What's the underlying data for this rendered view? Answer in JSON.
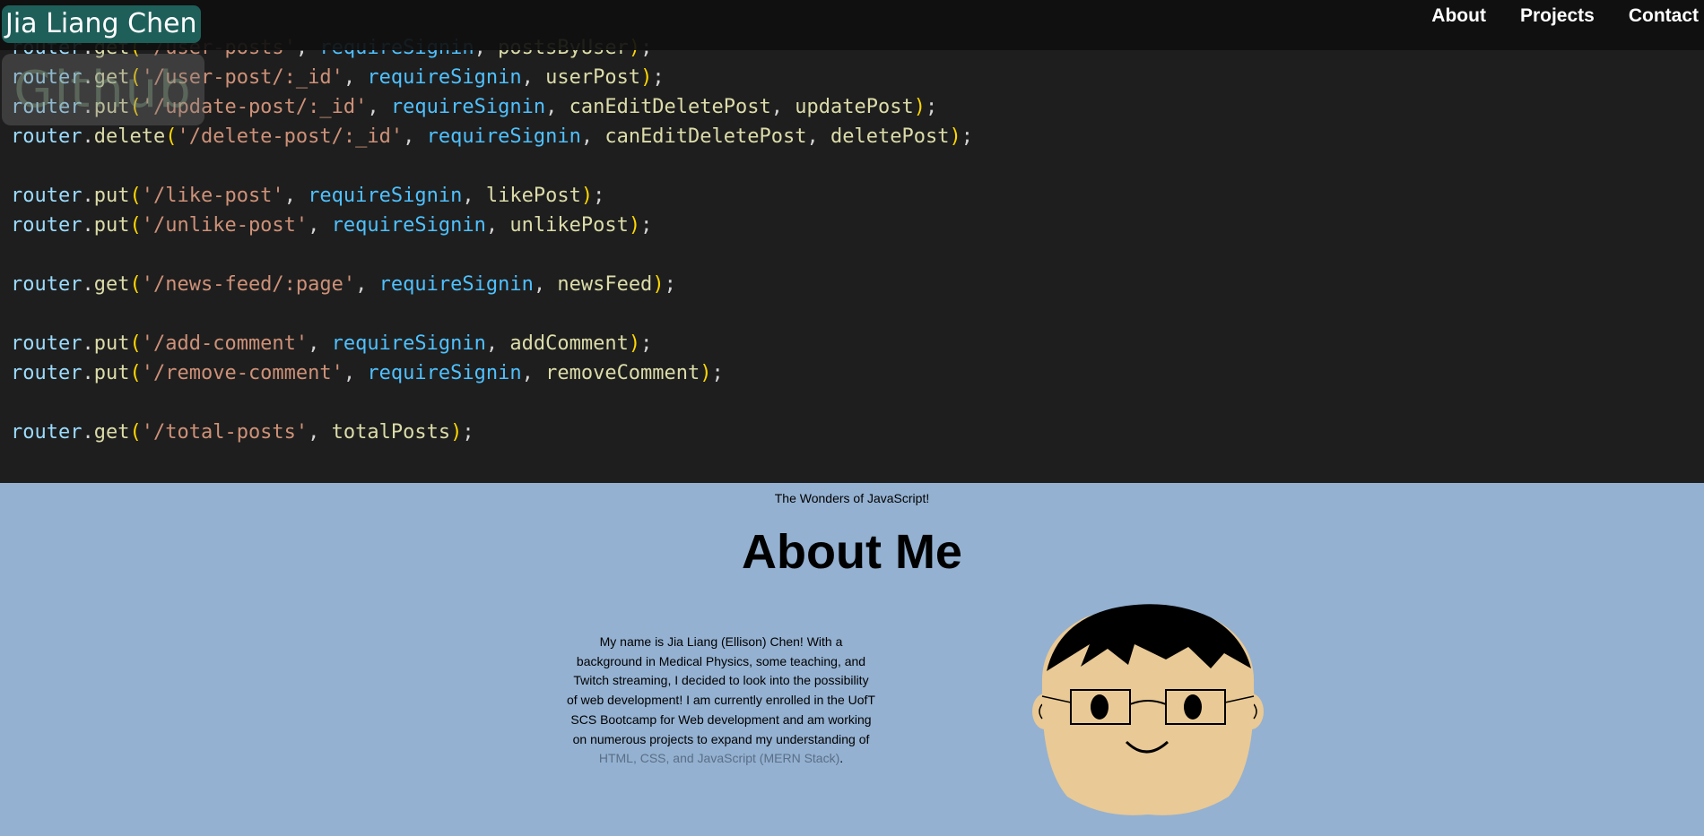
{
  "nav": {
    "brand": "Jia Liang Chen",
    "links": [
      "About",
      "Projects",
      "Contact"
    ]
  },
  "hero": {
    "github_label": "Github",
    "code_lines": [
      [
        {
          "t": "router",
          "c": "obj"
        },
        {
          "t": ".",
          "c": "punc"
        },
        {
          "t": "get",
          "c": "fn"
        },
        {
          "t": "(",
          "c": "paren"
        },
        {
          "t": "'/user-posts'",
          "c": "str"
        },
        {
          "t": ", ",
          "c": "punc"
        },
        {
          "t": "requireSignin",
          "c": "mw"
        },
        {
          "t": ", ",
          "c": "punc"
        },
        {
          "t": "postsByUser",
          "c": "handler"
        },
        {
          "t": ")",
          "c": "paren"
        },
        {
          "t": ";",
          "c": "punc"
        }
      ],
      [
        {
          "t": "router",
          "c": "obj"
        },
        {
          "t": ".",
          "c": "punc"
        },
        {
          "t": "get",
          "c": "fn"
        },
        {
          "t": "(",
          "c": "paren"
        },
        {
          "t": "'/user-post/:_id'",
          "c": "str"
        },
        {
          "t": ", ",
          "c": "punc"
        },
        {
          "t": "requireSignin",
          "c": "mw"
        },
        {
          "t": ", ",
          "c": "punc"
        },
        {
          "t": "userPost",
          "c": "handler"
        },
        {
          "t": ")",
          "c": "paren"
        },
        {
          "t": ";",
          "c": "punc"
        }
      ],
      [
        {
          "t": "router",
          "c": "obj"
        },
        {
          "t": ".",
          "c": "punc"
        },
        {
          "t": "put",
          "c": "fn"
        },
        {
          "t": "(",
          "c": "paren"
        },
        {
          "t": "'/update-post/:_id'",
          "c": "str"
        },
        {
          "t": ", ",
          "c": "punc"
        },
        {
          "t": "requireSignin",
          "c": "mw"
        },
        {
          "t": ", ",
          "c": "punc"
        },
        {
          "t": "canEditDeletePost",
          "c": "handler"
        },
        {
          "t": ", ",
          "c": "punc"
        },
        {
          "t": "updatePost",
          "c": "handler"
        },
        {
          "t": ")",
          "c": "paren"
        },
        {
          "t": ";",
          "c": "punc"
        }
      ],
      [
        {
          "t": "router",
          "c": "obj"
        },
        {
          "t": ".",
          "c": "punc"
        },
        {
          "t": "delete",
          "c": "fn"
        },
        {
          "t": "(",
          "c": "paren"
        },
        {
          "t": "'/delete-post/:_id'",
          "c": "str"
        },
        {
          "t": ", ",
          "c": "punc"
        },
        {
          "t": "requireSignin",
          "c": "mw"
        },
        {
          "t": ", ",
          "c": "punc"
        },
        {
          "t": "canEditDeletePost",
          "c": "handler"
        },
        {
          "t": ", ",
          "c": "punc"
        },
        {
          "t": "deletePost",
          "c": "handler"
        },
        {
          "t": ")",
          "c": "paren"
        },
        {
          "t": ";",
          "c": "punc"
        }
      ],
      [],
      [
        {
          "t": "router",
          "c": "obj"
        },
        {
          "t": ".",
          "c": "punc"
        },
        {
          "t": "put",
          "c": "fn"
        },
        {
          "t": "(",
          "c": "paren"
        },
        {
          "t": "'/like-post'",
          "c": "str"
        },
        {
          "t": ", ",
          "c": "punc"
        },
        {
          "t": "requireSignin",
          "c": "mw"
        },
        {
          "t": ", ",
          "c": "punc"
        },
        {
          "t": "likePost",
          "c": "handler"
        },
        {
          "t": ")",
          "c": "paren"
        },
        {
          "t": ";",
          "c": "punc"
        }
      ],
      [
        {
          "t": "router",
          "c": "obj"
        },
        {
          "t": ".",
          "c": "punc"
        },
        {
          "t": "put",
          "c": "fn"
        },
        {
          "t": "(",
          "c": "paren"
        },
        {
          "t": "'/unlike-post'",
          "c": "str"
        },
        {
          "t": ", ",
          "c": "punc"
        },
        {
          "t": "requireSignin",
          "c": "mw"
        },
        {
          "t": ", ",
          "c": "punc"
        },
        {
          "t": "unlikePost",
          "c": "handler"
        },
        {
          "t": ")",
          "c": "paren"
        },
        {
          "t": ";",
          "c": "punc"
        }
      ],
      [],
      [
        {
          "t": "router",
          "c": "obj"
        },
        {
          "t": ".",
          "c": "punc"
        },
        {
          "t": "get",
          "c": "fn"
        },
        {
          "t": "(",
          "c": "paren"
        },
        {
          "t": "'/news-feed/:page'",
          "c": "str"
        },
        {
          "t": ", ",
          "c": "punc"
        },
        {
          "t": "requireSignin",
          "c": "mw"
        },
        {
          "t": ", ",
          "c": "punc"
        },
        {
          "t": "newsFeed",
          "c": "handler"
        },
        {
          "t": ")",
          "c": "paren"
        },
        {
          "t": ";",
          "c": "punc"
        }
      ],
      [],
      [
        {
          "t": "router",
          "c": "obj"
        },
        {
          "t": ".",
          "c": "punc"
        },
        {
          "t": "put",
          "c": "fn"
        },
        {
          "t": "(",
          "c": "paren"
        },
        {
          "t": "'/add-comment'",
          "c": "str"
        },
        {
          "t": ", ",
          "c": "punc"
        },
        {
          "t": "requireSignin",
          "c": "mw"
        },
        {
          "t": ", ",
          "c": "punc"
        },
        {
          "t": "addComment",
          "c": "handler"
        },
        {
          "t": ")",
          "c": "paren"
        },
        {
          "t": ";",
          "c": "punc"
        }
      ],
      [
        {
          "t": "router",
          "c": "obj"
        },
        {
          "t": ".",
          "c": "punc"
        },
        {
          "t": "put",
          "c": "fn"
        },
        {
          "t": "(",
          "c": "paren"
        },
        {
          "t": "'/remove-comment'",
          "c": "str"
        },
        {
          "t": ", ",
          "c": "punc"
        },
        {
          "t": "requireSignin",
          "c": "mw"
        },
        {
          "t": ", ",
          "c": "punc"
        },
        {
          "t": "removeComment",
          "c": "handler"
        },
        {
          "t": ")",
          "c": "paren"
        },
        {
          "t": ";",
          "c": "punc"
        }
      ],
      [],
      [
        {
          "t": "router",
          "c": "obj"
        },
        {
          "t": ".",
          "c": "punc"
        },
        {
          "t": "get",
          "c": "fn"
        },
        {
          "t": "(",
          "c": "paren"
        },
        {
          "t": "'/total-posts'",
          "c": "str"
        },
        {
          "t": ", ",
          "c": "punc"
        },
        {
          "t": "totalPosts",
          "c": "handler"
        },
        {
          "t": ")",
          "c": "paren"
        },
        {
          "t": ";",
          "c": "punc"
        }
      ]
    ]
  },
  "caption": "The Wonders of JavaScript!",
  "about": {
    "title": "About Me",
    "bio_text": "My name is Jia Liang (Ellison) Chen! With a background in Medical Physics, some teaching, and Twitch streaming, I decided to look into the possibility of web development! I am currently enrolled in the UofT SCS Bootcamp for Web development and am working on numerous projects to expand my understanding of ",
    "bio_link": "HTML, CSS, and JavaScript (MERN Stack)",
    "bio_end": "."
  },
  "colors": {
    "code_bg": "#1e1e1e",
    "brand_bg": "#1e5f5a",
    "page_bg": "#94b1d1",
    "face": "#e9c995",
    "hair": "#000000"
  }
}
